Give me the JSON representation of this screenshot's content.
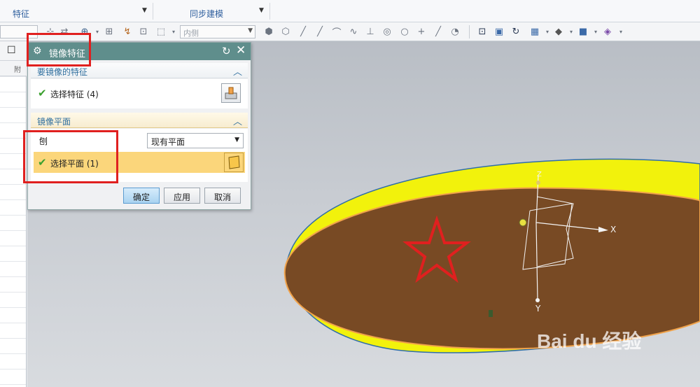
{
  "ribbon": {
    "groups": [
      {
        "label": "特征"
      },
      {
        "label": "同步建模"
      }
    ]
  },
  "toolbar": {
    "combo_value": "内侧",
    "icons": [
      "feature-tool-icon",
      "snap-icon",
      "point-icon",
      "curve-icon",
      "select-icon",
      "box-icon",
      "line-icon",
      "arc-icon",
      "circle-icon",
      "cross-icon",
      "fit-view-icon",
      "render-icon",
      "rotate-icon"
    ]
  },
  "navigator": {
    "header_glyph": "☐",
    "column_label": "附"
  },
  "dialog": {
    "title": "镜像特征",
    "sections": {
      "features": {
        "heading": "要镜像的特征",
        "row_label": "选择特征 (4)"
      },
      "plane": {
        "heading": "镜像平面",
        "plane_field_label": "刨",
        "plane_option": "现有平面",
        "row_label": "选择平面 (1)"
      }
    },
    "buttons": {
      "ok": "确定",
      "apply": "应用",
      "cancel": "取消"
    }
  },
  "viewport": {
    "axes": {
      "x": "X",
      "y": "Y",
      "z": "Z"
    },
    "watermark": "Bai du 经验",
    "colors": {
      "disc_top": "#784a24",
      "disc_side": "#f2f20c",
      "edge": "#f0a24a",
      "star": "#e0201f",
      "background": "#c4c9cf"
    }
  },
  "colors": {
    "dialog_title": "#5f8e8c",
    "active_row": "#fbd67b",
    "check": "#3aa02e",
    "annotation": "#e0201f"
  }
}
